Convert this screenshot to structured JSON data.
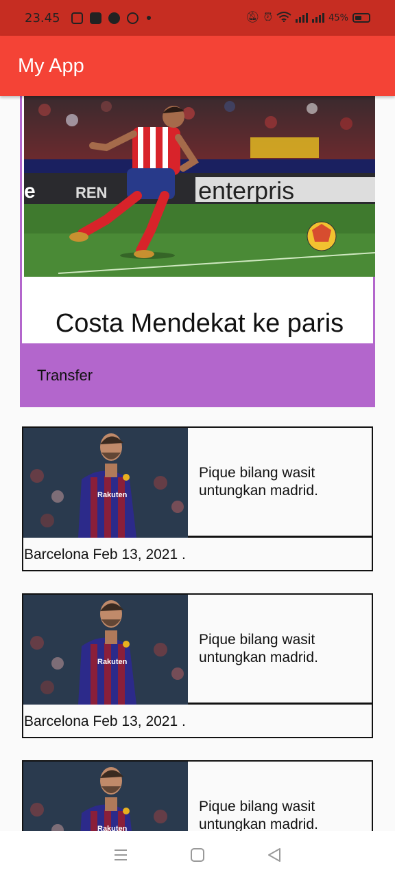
{
  "status_bar": {
    "time": "23.45",
    "battery": "45%",
    "left_icons": [
      "instagram-icon",
      "app-icon",
      "messenger-icon",
      "whatsapp-icon"
    ],
    "right_icons": [
      "mute-icon",
      "alarm-icon",
      "wifi-icon",
      "signal-icon",
      "signal-icon",
      "battery-icon"
    ]
  },
  "app_bar": {
    "title": "My App",
    "color": "#f44336"
  },
  "feature": {
    "title": "Costa Mendekat ke paris",
    "category": "Transfer",
    "accent": "#b366cc",
    "image": "football-player-photo"
  },
  "news": [
    {
      "headline": "Pique bilang wasit untungkan madrid.",
      "meta": "Barcelona Feb 13, 2021 .",
      "image": "player-photo"
    },
    {
      "headline": "Pique bilang wasit untungkan madrid.",
      "meta": "Barcelona Feb 13, 2021 .",
      "image": "player-photo"
    },
    {
      "headline": "Pique bilang wasit untungkan madrid.",
      "meta": "",
      "image": "player-photo"
    }
  ],
  "nav_bar": {
    "icons": [
      "menu-icon",
      "home-icon",
      "back-icon"
    ]
  }
}
